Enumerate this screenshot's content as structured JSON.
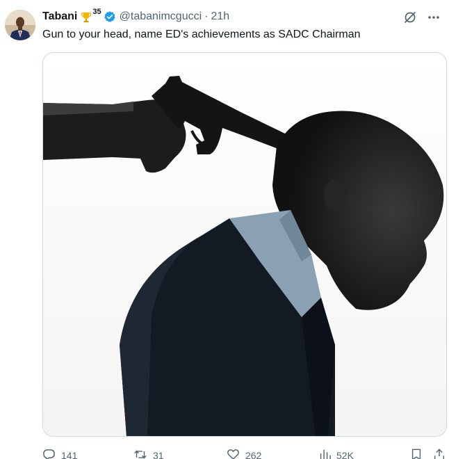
{
  "author": {
    "name": "Tabani",
    "badge_count": "35",
    "handle": "@tabanimcgucci",
    "separator": "·",
    "time": "21h"
  },
  "tweet": {
    "text": "Gun to your head, name ED's achievements as SADC Chairman"
  },
  "actions": {
    "replies": "141",
    "retweets": "31",
    "likes": "262",
    "views": "52K"
  },
  "icons": {
    "badge": "trophy-icon",
    "verified": "verified-badge-icon",
    "grok": "grok-icon",
    "more": "more-icon",
    "reply": "reply-icon",
    "retweet": "retweet-icon",
    "like": "heart-icon",
    "views": "views-icon",
    "bookmark": "bookmark-icon",
    "share": "share-icon"
  },
  "colors": {
    "verified": "#1d9bf0",
    "muted": "#536471",
    "text": "#0f1419"
  }
}
